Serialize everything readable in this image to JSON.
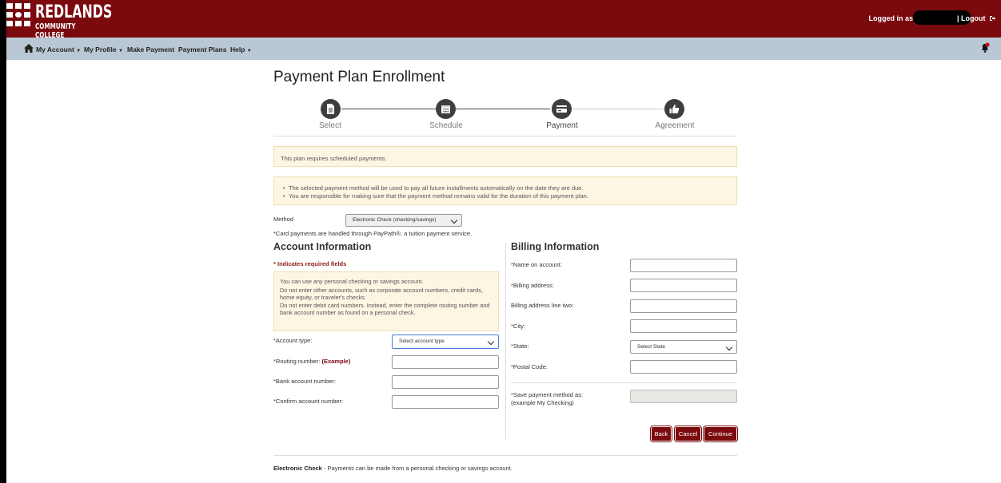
{
  "header": {
    "logo_title": "REDLANDS",
    "logo_subtitle": "COMMUNITY COLLEGE",
    "logged_in_label": "Logged in as:",
    "logout_label": "| Logout"
  },
  "nav": {
    "items": [
      {
        "label": "My Account"
      },
      {
        "label": "My Profile"
      },
      {
        "label": "Make Payment"
      },
      {
        "label": "Payment Plans"
      },
      {
        "label": "Help"
      }
    ]
  },
  "page": {
    "title": "Payment Plan Enrollment"
  },
  "steps": [
    {
      "label": "Select",
      "icon": "document-icon"
    },
    {
      "label": "Schedule",
      "icon": "calendar-icon"
    },
    {
      "label": "Payment",
      "icon": "credit-card-icon",
      "active": true
    },
    {
      "label": "Agreement",
      "icon": "thumbs-up-icon"
    }
  ],
  "alerts": {
    "scheduled": "This plan requires scheduled payments.",
    "bullets": [
      "The selected payment method will be used to pay all future installments automatically on the date they are due.",
      "You are responsible for making sure that the payment method remains valid for the duration of this payment plan."
    ]
  },
  "method": {
    "label": "Method",
    "selected": "Electronic Check (checking/savings)",
    "card_note": "*Card payments are handled through PayPath®, a tuition payment service."
  },
  "account": {
    "title": "Account Information",
    "required_note": "* Indicates required fields",
    "info": [
      "You can use any personal checking or savings account.",
      "Do not enter other accounts, such as corporate account numbers, credit cards, home equity, or traveler's checks.",
      "Do not enter debit card numbers. Instead, enter the complete routing number and bank account number as found on a personal check."
    ],
    "account_type_label": "Account type:",
    "account_type_selected": "Select account type",
    "routing_label": "Routing number:",
    "routing_example": "(Example)",
    "bank_label": "Bank account number:",
    "confirm_label": "Confirm account number:"
  },
  "billing": {
    "title": "Billing Information",
    "name_label": "Name on account:",
    "address_label": "Billing address:",
    "address2_label": "Billing address line two:",
    "city_label": "City:",
    "state_label": "State:",
    "state_selected": "Select State",
    "postal_label": "Postal Code:",
    "save_label": "Save payment method as:",
    "save_example": "(example My Checking)"
  },
  "buttons": {
    "back": "Back",
    "cancel": "Cancel",
    "continue": "Continue"
  },
  "footer": {
    "bold": "Electronic Check",
    "text": " - Payments can be made from a personal checking or savings account."
  },
  "colors": {
    "brand": "#7a0a0e",
    "nav_bg": "#b9c8d4",
    "alert_bg": "#fcf6e3"
  }
}
